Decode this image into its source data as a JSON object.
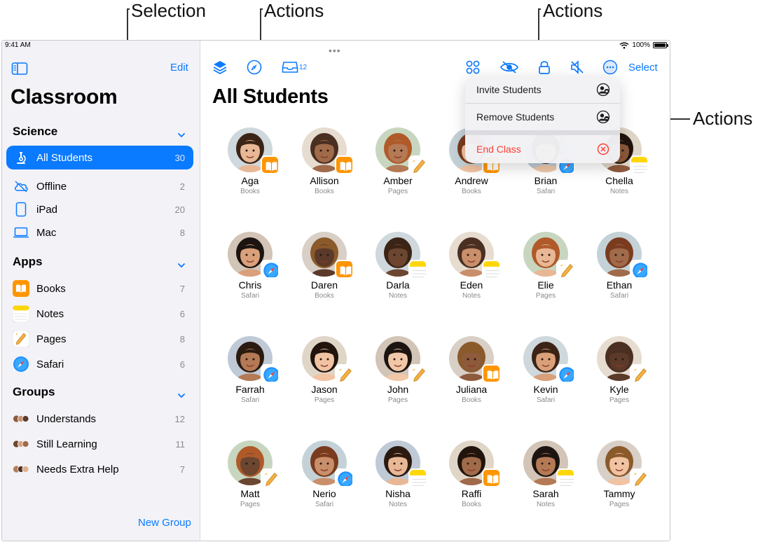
{
  "callouts": {
    "selection": "Selection",
    "actions_left": "Actions",
    "actions_right": "Actions",
    "actions_menu": "Actions"
  },
  "status": {
    "time": "9:41 AM",
    "battery": "100%"
  },
  "sidebar": {
    "edit": "Edit",
    "title": "Classroom",
    "sections": [
      {
        "title": "Science",
        "items": [
          {
            "label": "All Students",
            "count": "30",
            "icon": "microscope-icon",
            "active": true
          },
          {
            "label": "Offline",
            "count": "2",
            "icon": "cloud-offline-icon"
          },
          {
            "label": "iPad",
            "count": "20",
            "icon": "ipad-icon"
          },
          {
            "label": "Mac",
            "count": "8",
            "icon": "laptop-icon"
          }
        ]
      },
      {
        "title": "Apps",
        "items": [
          {
            "label": "Books",
            "count": "7",
            "icon": "books-icon"
          },
          {
            "label": "Notes",
            "count": "6",
            "icon": "notes-icon"
          },
          {
            "label": "Pages",
            "count": "8",
            "icon": "pages-icon"
          },
          {
            "label": "Safari",
            "count": "6",
            "icon": "safari-icon"
          }
        ]
      },
      {
        "title": "Groups",
        "items": [
          {
            "label": "Understands",
            "count": "12",
            "icon": "group-avatars-icon"
          },
          {
            "label": "Still Learning",
            "count": "11",
            "icon": "group-avatars-icon"
          },
          {
            "label": "Needs Extra Help",
            "count": "7",
            "icon": "group-avatars-icon"
          }
        ]
      }
    ],
    "new_group": "New Group"
  },
  "toolbar": {
    "inbox_badge": "12",
    "select": "Select"
  },
  "main": {
    "title": "All Students",
    "students": [
      {
        "name": "Aga",
        "app": "Books"
      },
      {
        "name": "Allison",
        "app": "Books"
      },
      {
        "name": "Amber",
        "app": "Pages"
      },
      {
        "name": "Andrew",
        "app": "Books"
      },
      {
        "name": "Brian",
        "app": "Safari"
      },
      {
        "name": "Chella",
        "app": "Notes"
      },
      {
        "name": "Chris",
        "app": "Safari"
      },
      {
        "name": "Daren",
        "app": "Books"
      },
      {
        "name": "Darla",
        "app": "Notes"
      },
      {
        "name": "Eden",
        "app": "Notes"
      },
      {
        "name": "Elie",
        "app": "Pages"
      },
      {
        "name": "Ethan",
        "app": "Safari"
      },
      {
        "name": "Farrah",
        "app": "Safari"
      },
      {
        "name": "Jason",
        "app": "Pages"
      },
      {
        "name": "John",
        "app": "Pages"
      },
      {
        "name": "Juliana",
        "app": "Books"
      },
      {
        "name": "Kevin",
        "app": "Safari"
      },
      {
        "name": "Kyle",
        "app": "Pages"
      },
      {
        "name": "Matt",
        "app": "Pages"
      },
      {
        "name": "Nerio",
        "app": "Safari"
      },
      {
        "name": "Nisha",
        "app": "Notes"
      },
      {
        "name": "Raffi",
        "app": "Books"
      },
      {
        "name": "Sarah",
        "app": "Notes"
      },
      {
        "name": "Tammy",
        "app": "Pages"
      }
    ]
  },
  "menu": {
    "items": [
      {
        "label": "Invite Students",
        "icon": "person-add-icon"
      },
      {
        "label": "Remove Students",
        "icon": "person-remove-icon"
      },
      {
        "label": "End Class",
        "icon": "close-circle-icon",
        "destructive": true
      }
    ]
  },
  "colors": {
    "accent": "#0a7aff",
    "destructive": "#ff3b30",
    "books": "#ff9500",
    "notes": "#ffd60a"
  }
}
